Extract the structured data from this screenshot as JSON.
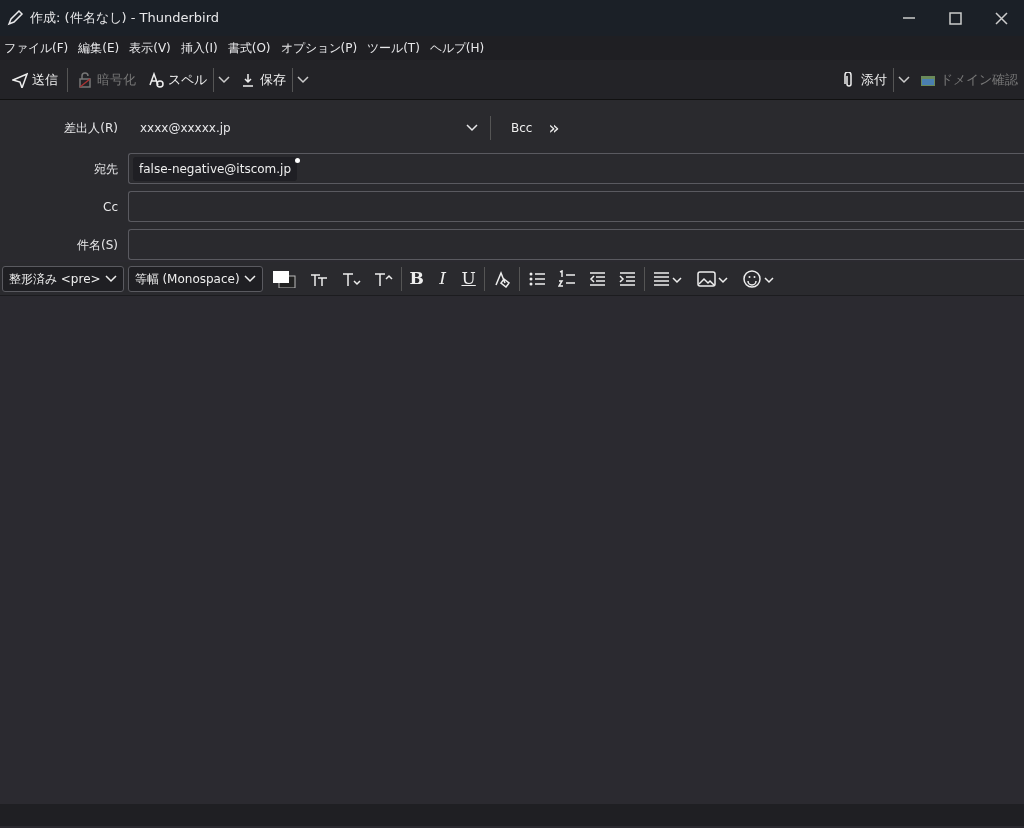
{
  "window": {
    "title": "作成: (件名なし) - Thunderbird"
  },
  "menu": [
    "ファイル(F)",
    "編集(E)",
    "表示(V)",
    "挿入(I)",
    "書式(O)",
    "オプション(P)",
    "ツール(T)",
    "ヘルプ(H)"
  ],
  "toolbar": [
    {
      "kind": "send",
      "label": "送信",
      "disabled": false
    },
    {
      "kind": "encrypt",
      "label": "暗号化",
      "disabled": true
    },
    {
      "kind": "spell",
      "label": "スペル",
      "disabled": false,
      "dropdown": true
    },
    {
      "kind": "save",
      "label": "保存",
      "disabled": false,
      "dropdown": true
    }
  ],
  "toolbar_right": [
    {
      "kind": "attach",
      "label": "添付",
      "disabled": false,
      "dropdown": true
    },
    {
      "kind": "domain",
      "label": "ドメイン確認",
      "disabled": true,
      "dropdown": false
    }
  ],
  "header": {
    "from": {
      "label": "差出人(R)",
      "value": "xxxx@xxxxx.jp",
      "extra": [
        "Bcc",
        "»"
      ]
    },
    "to": {
      "label": "宛先",
      "recipients": [
        "false-negative@itscom.jp"
      ]
    },
    "cc": {
      "label": "Cc"
    },
    "subject": {
      "label": "件名(S)"
    }
  },
  "format_bar": {
    "paragraph": "整形済み <pre>",
    "font": "等幅 (Monospace)",
    "bold": "B",
    "italic": "I",
    "underline": "U"
  }
}
